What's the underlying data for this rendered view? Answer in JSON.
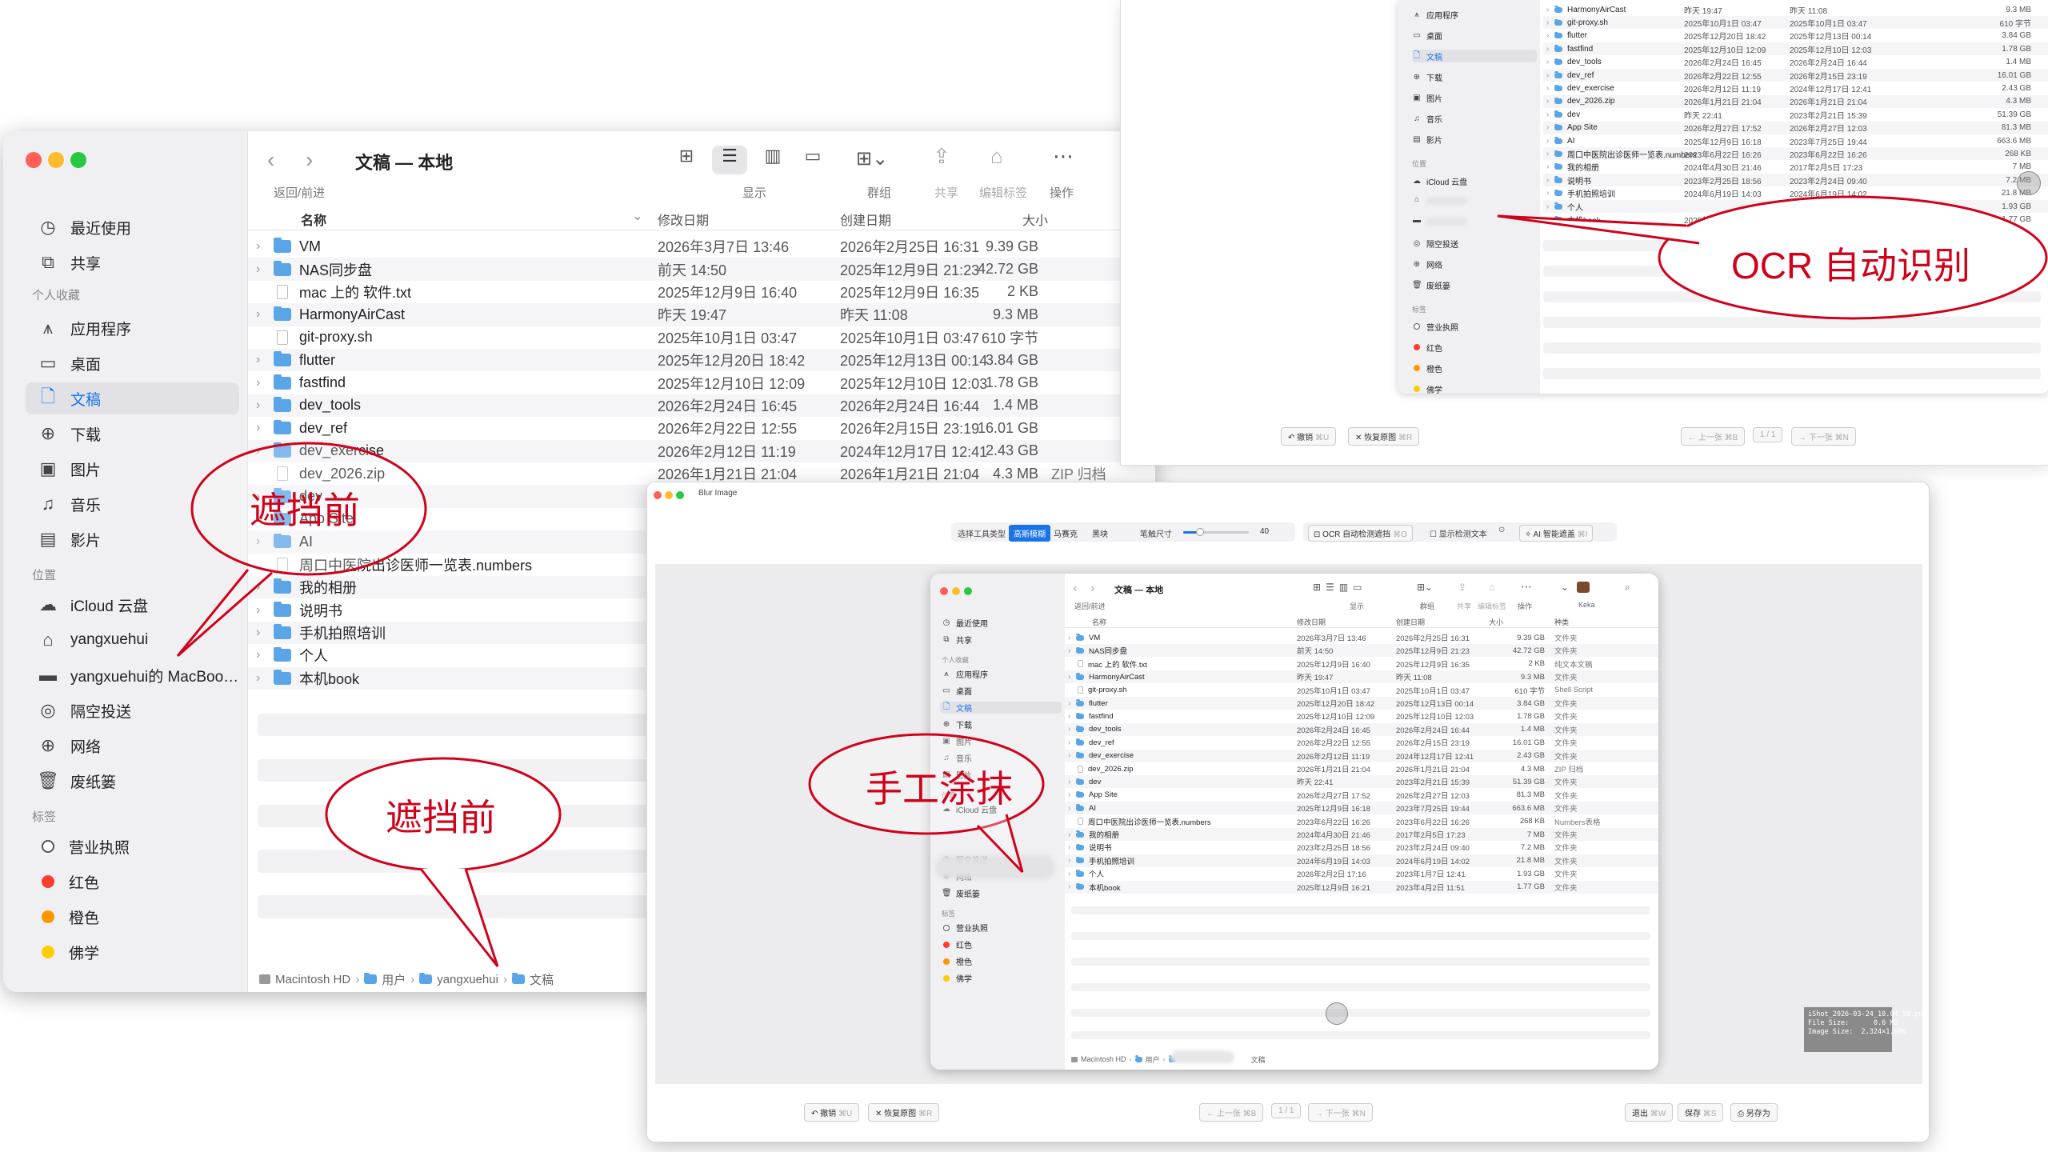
{
  "finder_main": {
    "title": "文稿 — 本地",
    "nav_caption": "返回/前进",
    "toolbar": {
      "display": "显示",
      "group": "群组",
      "share": "共享",
      "edit_tags": "编辑标签",
      "action": "操作"
    },
    "columns": {
      "name": "名称",
      "modified": "修改日期",
      "created": "创建日期",
      "size": "大小"
    },
    "sidebar": {
      "recents": "最近使用",
      "shared": "共享",
      "favorites_header": "个人收藏",
      "applications": "应用程序",
      "desktop": "桌面",
      "documents": "文稿",
      "downloads": "下载",
      "pictures": "图片",
      "music": "音乐",
      "movies": "影片",
      "locations_header": "位置",
      "icloud": "iCloud 云盘",
      "user": "yangxuehui",
      "macbook": "yangxuehui的 MacBoo…",
      "airdrop": "隔空投送",
      "network": "网络",
      "trash": "废纸篓",
      "tags_header": "标签",
      "tag_license": "营业执照",
      "tag_red": "红色",
      "tag_orange": "橙色",
      "tag_study": "佛学"
    },
    "rows": [
      {
        "name": "VM",
        "kind": "folder",
        "modified": "2026年3月7日 13:46",
        "created": "2026年2月25日 16:31",
        "size": "9.39 GB"
      },
      {
        "name": "NAS同步盘",
        "kind": "folder",
        "modified": "前天 14:50",
        "created": "2025年12月9日 21:23",
        "size": "42.72 GB"
      },
      {
        "name": "mac 上的 软件.txt",
        "kind": "file",
        "modified": "2025年12月9日 16:40",
        "created": "2025年12月9日 16:35",
        "size": "2 KB"
      },
      {
        "name": "HarmonyAirCast",
        "kind": "folder",
        "modified": "昨天 19:47",
        "created": "昨天 11:08",
        "size": "9.3 MB"
      },
      {
        "name": "git-proxy.sh",
        "kind": "file",
        "modified": "2025年10月1日 03:47",
        "created": "2025年10月1日 03:47",
        "size": "610 字节"
      },
      {
        "name": "flutter",
        "kind": "folder",
        "modified": "2025年12月20日 18:42",
        "created": "2025年12月13日 00:14",
        "size": "3.84 GB"
      },
      {
        "name": "fastfind",
        "kind": "folder",
        "modified": "2025年12月10日 12:09",
        "created": "2025年12月10日 12:03",
        "size": "1.78 GB"
      },
      {
        "name": "dev_tools",
        "kind": "folder",
        "modified": "2026年2月24日 16:45",
        "created": "2026年2月24日 16:44",
        "size": "1.4 MB"
      },
      {
        "name": "dev_ref",
        "kind": "folder",
        "modified": "2026年2月22日 12:55",
        "created": "2026年2月15日 23:19",
        "size": "16.01 GB"
      },
      {
        "name": "dev_exercise",
        "kind": "folder",
        "modified": "2026年2月12日 11:19",
        "created": "2024年12月17日 12:41",
        "size": "2.43 GB"
      },
      {
        "name": "dev_2026.zip",
        "kind": "file",
        "modified": "2026年1月21日 21:04",
        "created": "2026年1月21日 21:04",
        "size": "4.3 MB",
        "extra": "ZIP 归档"
      },
      {
        "name": "dev",
        "kind": "folder",
        "modified": "",
        "created": "",
        "size": ""
      },
      {
        "name": "App Site",
        "kind": "folder",
        "modified": "",
        "created": "",
        "size": ""
      },
      {
        "name": "AI",
        "kind": "folder",
        "modified": "",
        "created": "",
        "size": ""
      },
      {
        "name": "周口中医院出诊医师一览表.numbers",
        "kind": "file",
        "modified": "",
        "created": "",
        "size": ""
      },
      {
        "name": "我的相册",
        "kind": "folder",
        "modified": "",
        "created": "",
        "size": ""
      },
      {
        "name": "说明书",
        "kind": "folder",
        "modified": "",
        "created": "",
        "size": ""
      },
      {
        "name": "手机拍照培训",
        "kind": "folder",
        "modified": "",
        "created": "",
        "size": ""
      },
      {
        "name": "个人",
        "kind": "folder",
        "modified": "",
        "created": "",
        "size": ""
      },
      {
        "name": "本机book",
        "kind": "folder",
        "modified": "",
        "created": "",
        "size": ""
      }
    ],
    "path": [
      "Macintosh HD",
      "用户",
      "yangxuehui",
      "文稿"
    ]
  },
  "callouts": {
    "before_1": "遮挡前",
    "before_2": "遮挡前",
    "ocr": "OCR 自动识别",
    "manual": "手工涂抹"
  },
  "ocr_panel": {
    "sidebar": [
      "应用程序",
      "桌面",
      "文稿",
      "下载",
      "图片",
      "音乐",
      "影片",
      "位置",
      "iCloud 云盘",
      "隔空投送",
      "网络",
      "废纸篓",
      "标签",
      "营业执照",
      "红色",
      "橙色",
      "佛学"
    ],
    "rows": [
      {
        "name": "HarmonyAirCast",
        "modified": "昨天 19:47",
        "created": "昨天 11:08",
        "size": "9.3 MB"
      },
      {
        "name": "git-proxy.sh",
        "modified": "2025年10月1日 03:47",
        "created": "2025年10月1日 03:47",
        "size": "610 字节"
      },
      {
        "name": "flutter",
        "modified": "2025年12月20日 18:42",
        "created": "2025年12月13日 00:14",
        "size": "3.84 GB"
      },
      {
        "name": "fastfind",
        "modified": "2025年12月10日 12:09",
        "created": "2025年12月10日 12:03",
        "size": "1.78 GB"
      },
      {
        "name": "dev_tools",
        "modified": "2026年2月24日 16:45",
        "created": "2026年2月24日 16:44",
        "size": "1.4 MB"
      },
      {
        "name": "dev_ref",
        "modified": "2026年2月22日 12:55",
        "created": "2026年2月15日 23:19",
        "size": "16.01 GB"
      },
      {
        "name": "dev_exercise",
        "modified": "2026年2月12日 11:19",
        "created": "2024年12月17日 12:41",
        "size": "2.43 GB"
      },
      {
        "name": "dev_2026.zip",
        "modified": "2026年1月21日 21:04",
        "created": "2026年1月21日 21:04",
        "size": "4.3 MB"
      },
      {
        "name": "dev",
        "modified": "昨天 22:41",
        "created": "2023年2月21日 15:39",
        "size": "51.39 GB"
      },
      {
        "name": "App Site",
        "modified": "2026年2月27日 17:52",
        "created": "2026年2月27日 12:03",
        "size": "81.3 MB"
      },
      {
        "name": "AI",
        "modified": "2025年12月9日 16:18",
        "created": "2023年7月25日 19:44",
        "size": "663.6 MB"
      },
      {
        "name": "周口中医院出诊医师一览表.numbers",
        "modified": "2023年6月22日 16:26",
        "created": "2023年6月22日 16:26",
        "size": "268 KB"
      },
      {
        "name": "我的相册",
        "modified": "2024年4月30日 21:46",
        "created": "2017年2月5日 17:23",
        "size": "7 MB"
      },
      {
        "name": "说明书",
        "modified": "2023年2月25日 18:56",
        "created": "2023年2月24日 09:40",
        "size": "7.2 MB"
      },
      {
        "name": "手机拍照培训",
        "modified": "2024年6月19日 14:03",
        "created": "2024年6月19日 14:02",
        "size": "21.8 MB"
      },
      {
        "name": "个人",
        "modified": "",
        "created": "2023年1月7日 12:41",
        "size": "1.93 GB"
      },
      {
        "name": "本机book",
        "modified": "2025年12月9日 16:21",
        "created": "2023年4月2日 11:51",
        "size": "1.77 GB"
      }
    ],
    "bottom": {
      "undo": "撤销",
      "undo_key": "⌘U",
      "restore": "恢复原图",
      "restore_key": "⌘R",
      "prev": "← 上一张",
      "prev_key": "⌘B",
      "page": "1 / 1",
      "next": "→ 下一张",
      "next_key": "⌘N"
    }
  },
  "blur_app": {
    "title": "Blur Image",
    "tool_type_label": "选择工具类型",
    "tools": [
      "高斯模糊",
      "马赛克",
      "黑块"
    ],
    "brush_label": "笔触尺寸",
    "brush_value": "40",
    "brush_fraction": 0.25,
    "ocr_auto": "OCR 自动检测遮挡",
    "ocr_auto_key": "⌘O",
    "show_text": "显示检测文本",
    "ai_cover": "AI 智能遮盖",
    "ai_cover_key": "⌘I",
    "info": "iShot_2026-03-24_10.04.59.png\nFile Size:      0.6 MB\nImage Size:  2,324×1,606",
    "bottom": {
      "undo": "撤销",
      "undo_key": "⌘U",
      "restore": "恢复原图",
      "restore_key": "⌘R",
      "prev": "← 上一张",
      "prev_key": "⌘B",
      "page": "1 / 1",
      "next": "→ 下一张",
      "next_key": "⌘N",
      "exit": "退出",
      "exit_key": "⌘W",
      "save": "保存",
      "save_key": "⌘S",
      "save_as": "另存为"
    }
  },
  "mini_finder": {
    "title": "文稿 — 本地",
    "nav_caption": "返回/前进",
    "toolbar": {
      "display": "显示",
      "group": "群组",
      "share": "共享",
      "edit_tags": "编辑标签",
      "action": "操作",
      "keka": "Keka"
    },
    "columns": {
      "name": "名称",
      "modified": "修改日期",
      "created": "创建日期",
      "size": "大小",
      "kind": "种类"
    },
    "sidebar": [
      "最近使用",
      "共享",
      "个人收藏",
      "应用程序",
      "桌面",
      "文稿",
      "下载",
      "图片",
      "音乐",
      "影片",
      "位置",
      "iCloud 云盘",
      "隔空投送",
      "网络",
      "废纸篓",
      "标签",
      "营业执照",
      "红色",
      "橙色",
      "佛学"
    ],
    "rows": [
      {
        "name": "VM",
        "modified": "2026年3月7日 13:46",
        "created": "2026年2月25日 16:31",
        "size": "9.39 GB",
        "kind": "文件夹"
      },
      {
        "name": "NAS同步盘",
        "modified": "前天 14:50",
        "created": "2025年12月9日 21:23",
        "size": "42.72 GB",
        "kind": "文件夹"
      },
      {
        "name": "mac 上的 软件.txt",
        "modified": "2025年12月9日 16:40",
        "created": "2025年12月9日 16:35",
        "size": "2 KB",
        "kind": "纯文本文稿"
      },
      {
        "name": "HarmonyAirCast",
        "modified": "昨天 19:47",
        "created": "昨天 11:08",
        "size": "9.3 MB",
        "kind": "文件夹"
      },
      {
        "name": "git-proxy.sh",
        "modified": "2025年10月1日 03:47",
        "created": "2025年10月1日 03:47",
        "size": "610 字节",
        "kind": "Shell Script"
      },
      {
        "name": "flutter",
        "modified": "2025年12月20日 18:42",
        "created": "2025年12月13日 00:14",
        "size": "3.84 GB",
        "kind": "文件夹"
      },
      {
        "name": "fastfind",
        "modified": "2025年12月10日 12:09",
        "created": "2025年12月10日 12:03",
        "size": "1.78 GB",
        "kind": "文件夹"
      },
      {
        "name": "dev_tools",
        "modified": "2026年2月24日 16:45",
        "created": "2026年2月24日 16:44",
        "size": "1.4 MB",
        "kind": "文件夹"
      },
      {
        "name": "dev_ref",
        "modified": "2026年2月22日 12:55",
        "created": "2026年2月15日 23:19",
        "size": "16.01 GB",
        "kind": "文件夹"
      },
      {
        "name": "dev_exercise",
        "modified": "2026年2月12日 11:19",
        "created": "2024年12月17日 12:41",
        "size": "2.43 GB",
        "kind": "文件夹"
      },
      {
        "name": "dev_2026.zip",
        "modified": "2026年1月21日 21:04",
        "created": "2026年1月21日 21:04",
        "size": "4.3 MB",
        "kind": "ZIP 归档"
      },
      {
        "name": "dev",
        "modified": "昨天 22:41",
        "created": "2023年2月21日 15:39",
        "size": "51.39 GB",
        "kind": "文件夹"
      },
      {
        "name": "App Site",
        "modified": "2026年2月27日 17:52",
        "created": "2026年2月27日 12:03",
        "size": "81.3 MB",
        "kind": "文件夹"
      },
      {
        "name": "AI",
        "modified": "2025年12月9日 16:18",
        "created": "2023年7月25日 19:44",
        "size": "663.6 MB",
        "kind": "文件夹"
      },
      {
        "name": "周口中医院出诊医师一览表.numbers",
        "modified": "2023年6月22日 16:26",
        "created": "2023年6月22日 16:26",
        "size": "268 KB",
        "kind": "Numbers表格"
      },
      {
        "name": "我的相册",
        "modified": "2024年4月30日 21:46",
        "created": "2017年2月5日 17:23",
        "size": "7 MB",
        "kind": "文件夹"
      },
      {
        "name": "说明书",
        "modified": "2023年2月25日 18:56",
        "created": "2023年2月24日 09:40",
        "size": "7.2 MB",
        "kind": "文件夹"
      },
      {
        "name": "手机拍照培训",
        "modified": "2024年6月19日 14:03",
        "created": "2024年6月19日 14:02",
        "size": "21.8 MB",
        "kind": "文件夹"
      },
      {
        "name": "个人",
        "modified": "2026年2月2日 17:16",
        "created": "2023年1月7日 12:41",
        "size": "1.93 GB",
        "kind": "文件夹"
      },
      {
        "name": "本机book",
        "modified": "2025年12月9日 16:21",
        "created": "2023年4月2日 11:51",
        "size": "1.77 GB",
        "kind": "文件夹"
      }
    ],
    "path": [
      "Macintosh HD",
      "用户",
      "文稿"
    ]
  }
}
